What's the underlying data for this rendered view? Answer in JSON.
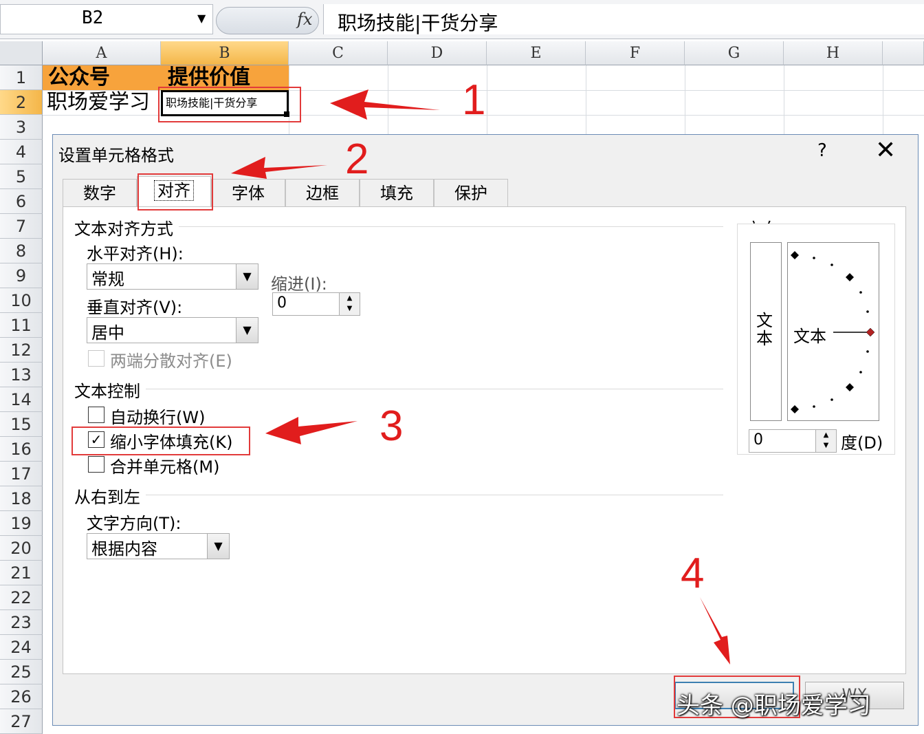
{
  "formula_bar": {
    "name_box": "B2",
    "fx_label": "fx",
    "formula": "职场技能|干货分享"
  },
  "sheet": {
    "columns": [
      "A",
      "B",
      "C",
      "D",
      "E",
      "F",
      "G",
      "H"
    ],
    "rows": [
      "1",
      "2",
      "3",
      "4",
      "5",
      "6",
      "7",
      "8",
      "9",
      "10",
      "11",
      "12",
      "13",
      "14",
      "15",
      "16",
      "17",
      "18",
      "19",
      "20",
      "21",
      "22",
      "23",
      "24",
      "25",
      "26",
      "27"
    ],
    "cells": {
      "A1": "公众号",
      "B1": "提供价值",
      "A2": "职场爱学习",
      "B2": "职场技能|干货分享"
    }
  },
  "callouts": [
    "1",
    "2",
    "3",
    "4"
  ],
  "dialog": {
    "title": "设置单元格格式",
    "help": "?",
    "close": "✕",
    "tabs": [
      "数字",
      "对齐",
      "字体",
      "边框",
      "填充",
      "保护"
    ],
    "active_tab": "对齐",
    "text_alignment": {
      "group": "文本对齐方式",
      "horizontal_label": "水平对齐(H):",
      "horizontal_value": "常规",
      "indent_label": "缩进(I):",
      "indent_value": "0",
      "vertical_label": "垂直对齐(V):",
      "vertical_value": "居中",
      "justify_distributed": "两端分散对齐(E)"
    },
    "text_control": {
      "group": "文本控制",
      "wrap_text": "自动换行(W)",
      "shrink_to_fit": "缩小字体填充(K)",
      "merge_cells": "合并单元格(M)",
      "shrink_checked": true
    },
    "rtl": {
      "group": "从右到左",
      "direction_label": "文字方向(T):",
      "direction_value": "根据内容"
    },
    "orientation": {
      "group": "方向",
      "vertical_text": "文本",
      "text": "文本",
      "degree_value": "0",
      "degree_label": "度(D)"
    },
    "cancel_fragment": "WX"
  },
  "watermark": "头条 @职场爱学习",
  "colors": {
    "header_fill": "#f7a33c",
    "selected_header": "#f4b649",
    "callout_red": "#e11d1d"
  }
}
